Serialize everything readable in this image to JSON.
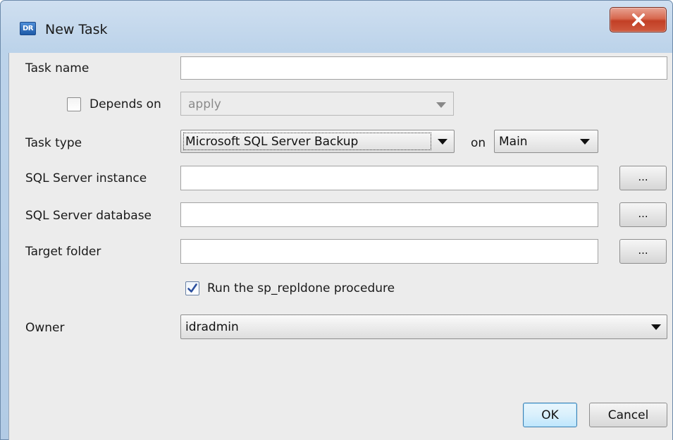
{
  "window": {
    "app_icon_text": "DR",
    "title": "New Task"
  },
  "form": {
    "task_name": {
      "label": "Task name",
      "value": ""
    },
    "depends_on": {
      "label": "Depends on",
      "checked": false,
      "value": "apply"
    },
    "task_type": {
      "label": "Task type",
      "value": "Microsoft SQL Server Backup",
      "on_label": "on",
      "on_value": "Main"
    },
    "sql_server_instance": {
      "label": "SQL Server instance",
      "value": "",
      "browse_label": "..."
    },
    "sql_server_database": {
      "label": "SQL Server database",
      "value": "",
      "browse_label": "..."
    },
    "target_folder": {
      "label": "Target folder",
      "value": "",
      "browse_label": "..."
    },
    "run_procedure": {
      "label": "Run the sp_repldone procedure",
      "checked": true
    },
    "owner": {
      "label": "Owner",
      "value": "idradmin"
    }
  },
  "buttons": {
    "ok": "OK",
    "cancel": "Cancel"
  },
  "colors": {
    "close_button": "#c9452a",
    "checkmark": "#2b4f9e",
    "default_button_border": "#3c7fb1"
  }
}
